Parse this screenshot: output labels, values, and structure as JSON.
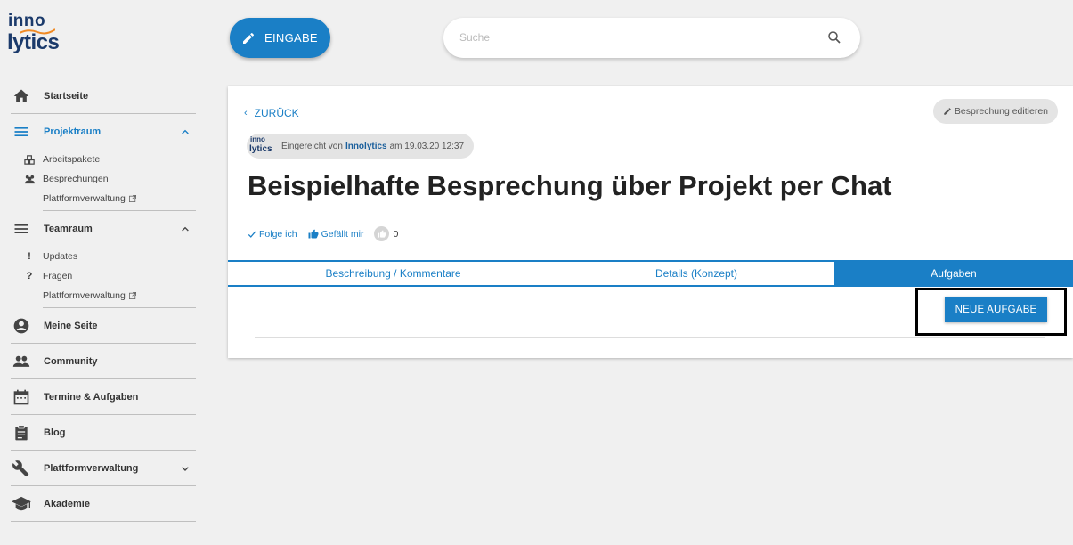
{
  "logo": {
    "line1": "inno",
    "line2": "lytics"
  },
  "sidebar": {
    "items": [
      {
        "label": "Startseite"
      },
      {
        "label": "Projektraum",
        "subitems": [
          {
            "label": "Arbeitspakete"
          },
          {
            "label": "Besprechungen"
          },
          {
            "label": "Plattformverwaltung"
          }
        ]
      },
      {
        "label": "Teamraum",
        "subitems": [
          {
            "label": "Updates"
          },
          {
            "label": "Fragen"
          },
          {
            "label": "Plattformverwaltung"
          }
        ]
      },
      {
        "label": "Meine Seite"
      },
      {
        "label": "Community"
      },
      {
        "label": "Termine & Aufgaben"
      },
      {
        "label": "Blog"
      },
      {
        "label": "Plattformverwaltung"
      },
      {
        "label": "Akademie"
      }
    ]
  },
  "topbar": {
    "eingabe_label": "EINGABE",
    "search_placeholder": "Suche"
  },
  "card": {
    "back_label": "ZURÜCK",
    "edit_label": "Besprechung editieren",
    "submitted_prefix": "Eingereicht von",
    "author": "Innolytics",
    "submitted_suffix": "am 19.03.20 12:37",
    "title": "Beispielhafte Besprechung über Projekt per Chat",
    "follow_label": "Folge ich",
    "like_label": "Gefällt mir",
    "like_count": "0",
    "tabs": [
      {
        "label": "Beschreibung / Kommentare"
      },
      {
        "label": "Details (Konzept)"
      },
      {
        "label": "Aufgaben"
      }
    ],
    "new_task_label": "NEUE AUFGABE"
  },
  "colors": {
    "accent": "#1a7fc6",
    "logo": "#1b3a6b",
    "background": "#f0f0f0"
  }
}
